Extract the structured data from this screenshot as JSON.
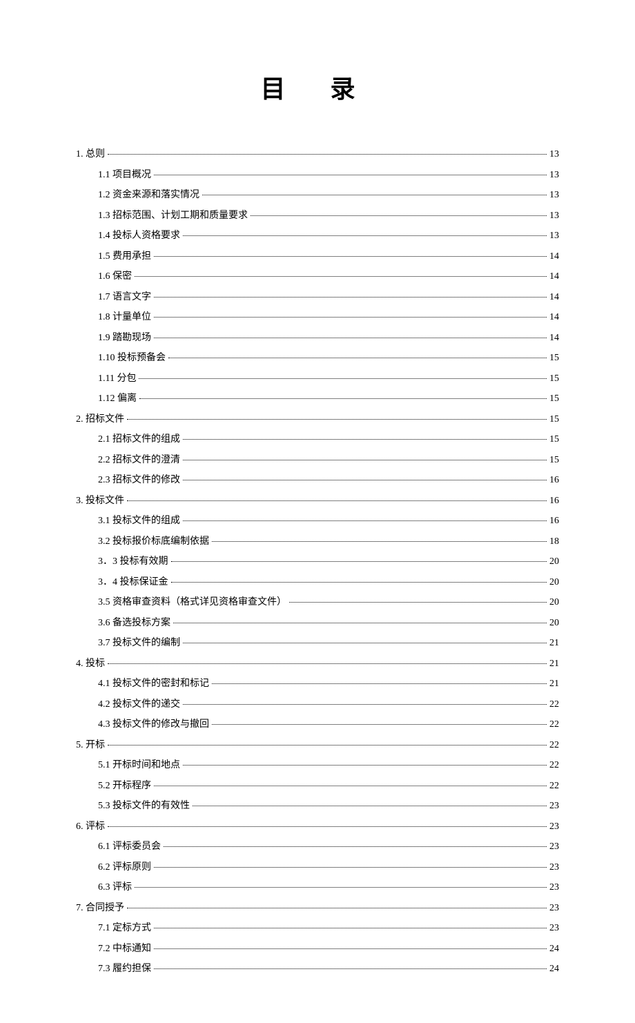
{
  "title": "目 录",
  "entries": [
    {
      "level": 1,
      "label": "1.  总则",
      "page": "13"
    },
    {
      "level": 2,
      "label": "1.1  项目概况",
      "page": "13"
    },
    {
      "level": 2,
      "label": "1.2  资金来源和落实情况",
      "page": "13"
    },
    {
      "level": 2,
      "label": "1.3  招标范围、计划工期和质量要求",
      "page": "13"
    },
    {
      "level": 2,
      "label": "1.4  投标人资格要求",
      "page": "13"
    },
    {
      "level": 2,
      "label": "1.5  费用承担",
      "page": "14"
    },
    {
      "level": 2,
      "label": "1.6  保密",
      "page": "14"
    },
    {
      "level": 2,
      "label": "1.7  语言文字",
      "page": "14"
    },
    {
      "level": 2,
      "label": "1.8  计量单位",
      "page": "14"
    },
    {
      "level": 2,
      "label": "1.9  踏勘现场",
      "page": "14"
    },
    {
      "level": 2,
      "label": "1.10  投标预备会",
      "page": "15"
    },
    {
      "level": 2,
      "label": "1.11  分包",
      "page": "15"
    },
    {
      "level": 2,
      "label": "1.12  偏离",
      "page": "15"
    },
    {
      "level": 1,
      "label": "2.  招标文件",
      "page": "15"
    },
    {
      "level": 2,
      "label": "2.1  招标文件的组成",
      "page": "15"
    },
    {
      "level": 2,
      "label": "2.2  招标文件的澄清",
      "page": "15"
    },
    {
      "level": 2,
      "label": "2.3  招标文件的修改",
      "page": "16"
    },
    {
      "level": 1,
      "label": "3.  投标文件",
      "page": "16"
    },
    {
      "level": 2,
      "label": "3.1  投标文件的组成",
      "page": "16"
    },
    {
      "level": 2,
      "label": "3.2  投标报价标底编制依据",
      "page": "18"
    },
    {
      "level": 2,
      "label": "3．3  投标有效期",
      "page": "20"
    },
    {
      "level": 2,
      "label": "3．4  投标保证金",
      "page": "20"
    },
    {
      "level": 2,
      "label": "3.5  资格审查资料（格式详见资格审查文件）",
      "page": "20"
    },
    {
      "level": 2,
      "label": "3.6  备选投标方案",
      "page": "20"
    },
    {
      "level": 2,
      "label": "3.7  投标文件的编制",
      "page": "21"
    },
    {
      "level": 1,
      "label": "4.  投标",
      "page": "21"
    },
    {
      "level": 2,
      "label": "4.1  投标文件的密封和标记",
      "page": "21"
    },
    {
      "level": 2,
      "label": "4.2  投标文件的递交",
      "page": "22"
    },
    {
      "level": 2,
      "label": "4.3  投标文件的修改与撤回",
      "page": "22"
    },
    {
      "level": 1,
      "label": "5.  开标",
      "page": "22"
    },
    {
      "level": 2,
      "label": "5.1  开标时间和地点",
      "page": "22"
    },
    {
      "level": 2,
      "label": "5.2  开标程序",
      "page": "22"
    },
    {
      "level": 2,
      "label": "5.3  投标文件的有效性",
      "page": "23"
    },
    {
      "level": 1,
      "label": "6.  评标",
      "page": "23"
    },
    {
      "level": 2,
      "label": "6.1  评标委员会",
      "page": "23"
    },
    {
      "level": 2,
      "label": "6.2  评标原则",
      "page": "23"
    },
    {
      "level": 2,
      "label": "6.3  评标",
      "page": "23"
    },
    {
      "level": 1,
      "label": "7.  合同授予",
      "page": "23"
    },
    {
      "level": 2,
      "label": "7.1  定标方式",
      "page": "23"
    },
    {
      "level": 2,
      "label": "7.2  中标通知",
      "page": "24"
    },
    {
      "level": 2,
      "label": "7.3  履约担保",
      "page": "24"
    }
  ]
}
